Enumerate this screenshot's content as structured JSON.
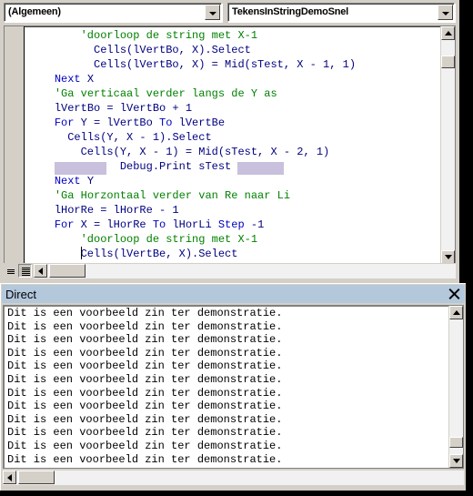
{
  "window": {
    "code_editor": {
      "object_combo": {
        "value": "(Algemeen)",
        "dropdown_icon": "chevron-down-icon"
      },
      "procedure_combo": {
        "value": "TekensInStringDemoSnel",
        "dropdown_icon": "chevron-down-icon"
      },
      "view_buttons": {
        "procedure_view_label": "Procedure View",
        "full_module_view_label": "Full Module View"
      },
      "code_lines": [
        {
          "indent": 8,
          "segments": [
            {
              "text": "'doorloop de string met X-1",
              "style": "comment"
            }
          ]
        },
        {
          "indent": 10,
          "segments": [
            {
              "text": "Cells(lVertBo, X).Select",
              "style": "plain"
            }
          ]
        },
        {
          "indent": 10,
          "segments": [
            {
              "text": "Cells(lVertBo, X) = Mid(sTest, X - 1, 1)",
              "style": "plain"
            }
          ]
        },
        {
          "indent": 4,
          "segments": [
            {
              "text": "Next",
              "style": "keyword"
            },
            {
              "text": " X",
              "style": "plain"
            }
          ]
        },
        {
          "indent": 4,
          "segments": [
            {
              "text": "'Ga verticaal verder langs de Y as",
              "style": "comment"
            }
          ]
        },
        {
          "indent": 4,
          "segments": [
            {
              "text": "lVertBo = lVertBo + 1",
              "style": "plain"
            }
          ]
        },
        {
          "indent": 4,
          "segments": [
            {
              "text": "For",
              "style": "keyword"
            },
            {
              "text": " Y = lVertBo ",
              "style": "plain"
            },
            {
              "text": "To",
              "style": "keyword"
            },
            {
              "text": " lVertBe",
              "style": "plain"
            }
          ]
        },
        {
          "indent": 6,
          "segments": [
            {
              "text": "Cells(Y, X - 1).Select",
              "style": "plain"
            }
          ]
        },
        {
          "indent": 8,
          "segments": [
            {
              "text": "Cells(Y, X - 1) = Mid(sTest, X - 2, 1)",
              "style": "plain"
            }
          ]
        },
        {
          "indent": 4,
          "segments": [
            {
              "text": "        ",
              "style": "selection"
            },
            {
              "text": "  Debug.Print sTest ",
              "style": "plain"
            },
            {
              "text": "       ",
              "style": "selection"
            }
          ]
        },
        {
          "indent": 4,
          "segments": [
            {
              "text": "Next",
              "style": "keyword"
            },
            {
              "text": " Y",
              "style": "plain"
            }
          ]
        },
        {
          "indent": 4,
          "segments": [
            {
              "text": "'Ga Horzontaal verder van Re naar Li",
              "style": "comment"
            }
          ]
        },
        {
          "indent": 4,
          "segments": [
            {
              "text": "lHorRe = lHorRe - 1",
              "style": "plain"
            }
          ]
        },
        {
          "indent": 4,
          "segments": [
            {
              "text": "For",
              "style": "keyword"
            },
            {
              "text": " X = lHorRe ",
              "style": "plain"
            },
            {
              "text": "To",
              "style": "keyword"
            },
            {
              "text": " lHorLi ",
              "style": "plain"
            },
            {
              "text": "Step",
              "style": "keyword"
            },
            {
              "text": " -1",
              "style": "plain"
            }
          ]
        },
        {
          "indent": 8,
          "segments": [
            {
              "text": "'doorloop de string met X-1",
              "style": "comment"
            }
          ]
        },
        {
          "indent": 8,
          "segments": [
            {
              "text": "Cells(lVertBe, X).Select",
              "style": "plain",
              "caret_before": true
            }
          ]
        }
      ]
    },
    "immediate_window": {
      "title": "Direct",
      "close_icon": "close-icon",
      "output_lines": [
        "Dit is een voorbeeld zin ter demonstratie.",
        "Dit is een voorbeeld zin ter demonstratie.",
        "Dit is een voorbeeld zin ter demonstratie.",
        "Dit is een voorbeeld zin ter demonstratie.",
        "Dit is een voorbeeld zin ter demonstratie.",
        "Dit is een voorbeeld zin ter demonstratie.",
        "Dit is een voorbeeld zin ter demonstratie.",
        "Dit is een voorbeeld zin ter demonstratie.",
        "Dit is een voorbeeld zin ter demonstratie.",
        "Dit is een voorbeeld zin ter demonstratie.",
        "Dit is een voorbeeld zin ter demonstratie.",
        "Dit is een voorbeeld zin ter demonstratie."
      ]
    }
  },
  "colors": {
    "comment": "#008000",
    "keyword": "#0000c0",
    "plain": "#000080",
    "selection": "#c8c0dc",
    "titlebar": "#b4c8dc",
    "chrome": "#d4d0c8"
  }
}
